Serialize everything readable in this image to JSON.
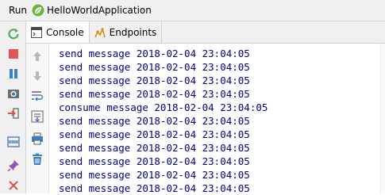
{
  "titlebar": {
    "run_label": "Run",
    "app_icon": "spring-leaf-icon",
    "app_name": "HelloWorldApplication"
  },
  "left_toolbar": [
    {
      "name": "rerun-icon",
      "color": "#59a869"
    },
    {
      "name": "stop-icon",
      "color": "#e05555"
    },
    {
      "name": "pause-icon",
      "color": "#3d7fc4"
    },
    {
      "name": "camera-icon",
      "color": "#5b5b5b"
    },
    {
      "name": "login-icon",
      "color": "#d9544f"
    },
    {
      "name": "layout-icon",
      "color": "#3d7fc4"
    },
    {
      "name": "pin-icon",
      "color": "#8a5bb5"
    },
    {
      "name": "close-icon",
      "color": "#d9544f"
    }
  ],
  "tabs": [
    {
      "label": "Console",
      "icon": "console-icon",
      "active": true
    },
    {
      "label": "Endpoints",
      "icon": "endpoints-icon",
      "active": false
    }
  ],
  "inner_toolbar": [
    "up-arrow-icon",
    "down-arrow-icon",
    "soft-wrap-icon",
    "scroll-to-end-icon",
    "print-icon",
    "trash-icon"
  ],
  "console": {
    "text_color": "#000080",
    "lines": [
      "send message 2018-02-04 23:04:05",
      "send message 2018-02-04 23:04:05",
      "send message 2018-02-04 23:04:05",
      "send message 2018-02-04 23:04:05",
      "consume message 2018-02-04 23:04:05",
      "send message 2018-02-04 23:04:05",
      "send message 2018-02-04 23:04:05",
      "send message 2018-02-04 23:04:05",
      "send message 2018-02-04 23:04:05",
      "send message 2018-02-04 23:04:05",
      "send message 2018-02-04 23:04:05"
    ]
  }
}
